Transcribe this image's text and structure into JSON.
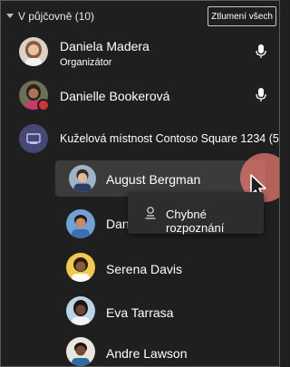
{
  "header": {
    "section_title": "V půjčovně (10)",
    "mute_all_label": "Ztlumení všech"
  },
  "participants": [
    {
      "name": "Daniela Madera",
      "role": "Organizátor",
      "has_mic": true
    },
    {
      "name": "Danielle Bookerová",
      "presence": "busy",
      "has_mic": true
    },
    {
      "name": "Kuželová místnost Contoso Square 1234 (5)",
      "type": "room"
    },
    {
      "name": "August Bergman",
      "selected": true
    },
    {
      "name": "Dan"
    },
    {
      "name": "Serena Davis"
    },
    {
      "name": "Eva Tarrasa"
    },
    {
      "name": "Andre Lawson"
    }
  ],
  "context_menu": {
    "items": [
      {
        "label": "Chybné rozpoznání",
        "icon": "person-icon"
      }
    ]
  },
  "colors": {
    "background": "#1f1f1f",
    "room_icon": "#464775",
    "presence_busy": "#d13438",
    "cursor_highlight": "#e6786e"
  }
}
